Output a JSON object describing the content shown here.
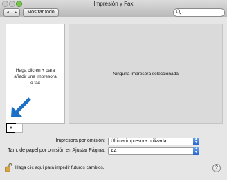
{
  "window": {
    "title": "Impresión y Fax",
    "nav_back": "◂",
    "nav_forward": "▸",
    "show_all_label": "Mostrar todo",
    "search_icon": "magnifier-icon",
    "search_placeholder": ""
  },
  "printer_list": {
    "hint_line1": "Haga clic en + para",
    "hint_line2": "añadir una impresora",
    "hint_line3": "o fax",
    "add_label": "+"
  },
  "detail": {
    "message": "Ninguna impresora seleccionada"
  },
  "settings": {
    "default_printer_label": "Impresora por omisión:",
    "default_printer_value": "Última impresora utilizada",
    "paper_size_label": "Tam. de papel por omisión en Ajustar Página:",
    "paper_size_value": "A4"
  },
  "footer": {
    "lock_text": "Haga clic aquí para impedir futuros cambios.",
    "help_label": "?"
  },
  "colors": {
    "arrow": "#1a6fc7",
    "select_arrow": "#2f6fd2",
    "zoom_light": "#79c34d"
  }
}
